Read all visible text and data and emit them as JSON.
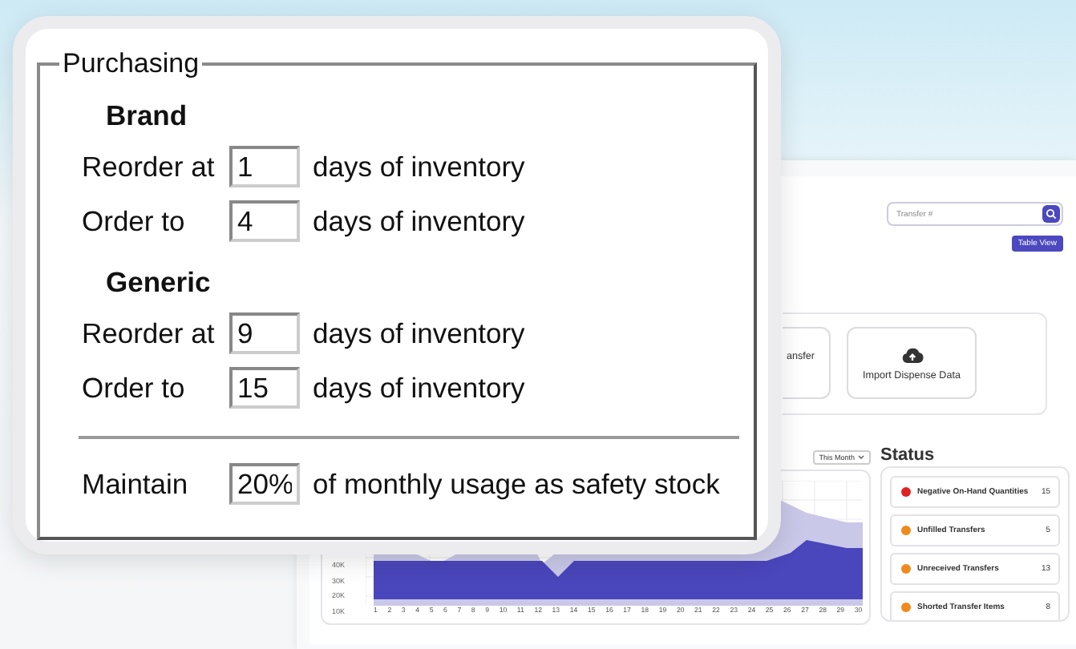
{
  "purchasing_panel": {
    "legend": "Purchasing",
    "groups": [
      {
        "heading": "Brand",
        "rows": [
          {
            "label": "Reorder at",
            "value": "1",
            "suffix": "days of inventory"
          },
          {
            "label": "Order to",
            "value": "4",
            "suffix": "days of inventory"
          }
        ]
      },
      {
        "heading": "Generic",
        "rows": [
          {
            "label": "Reorder at",
            "value": "9",
            "suffix": "days of inventory"
          },
          {
            "label": "Order to",
            "value": "15",
            "suffix": "days of inventory"
          }
        ]
      }
    ],
    "safety_stock": {
      "label": "Maintain",
      "value": "20%",
      "suffix": "of monthly usage as safety stock"
    }
  },
  "app": {
    "search": {
      "placeholder": "Transfer #"
    },
    "table_view_button": "Table View",
    "tiles": [
      {
        "label": "ansfer"
      },
      {
        "label": "Import Dispense Data"
      }
    ],
    "chart": {
      "range": "This Month",
      "y_labels": [
        "40K",
        "30K",
        "20K",
        "10K"
      ],
      "x_labels": [
        "1",
        "2",
        "3",
        "4",
        "5",
        "6",
        "7",
        "8",
        "9",
        "10",
        "11",
        "12",
        "13",
        "14",
        "15",
        "16",
        "17",
        "18",
        "19",
        "20",
        "21",
        "22",
        "23",
        "24",
        "25",
        "26",
        "27",
        "28",
        "29",
        "30"
      ]
    },
    "status": {
      "title": "Status",
      "items": [
        {
          "label": "Negative On-Hand Quantities",
          "count": "15",
          "color": "#e02424"
        },
        {
          "label": "Unfilled Transfers",
          "count": "5",
          "color": "#f08a1c"
        },
        {
          "label": "Unreceived Transfers",
          "count": "13",
          "color": "#f08a1c"
        },
        {
          "label": "Shorted Transfer Items",
          "count": "8",
          "color": "#f08a1c"
        }
      ]
    }
  }
}
